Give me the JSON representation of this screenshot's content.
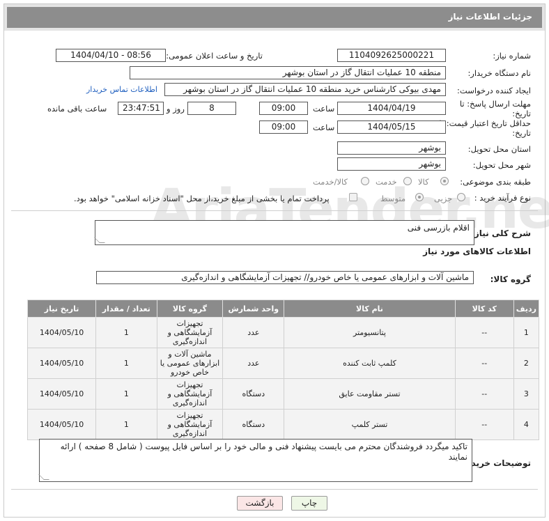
{
  "header": {
    "title": "جزئیات اطلاعات نیاز"
  },
  "fields": {
    "need_number_label": "شماره نیاز:",
    "need_number": "1104092625000221",
    "announce_label": "تاریخ و ساعت اعلان عمومی:",
    "announce_value": "1404/04/10 - 08:56",
    "buyer_org_label": "نام دستگاه خریدار:",
    "buyer_org": "منطقه 10 عملیات انتقال گاز در استان بوشهر",
    "requester_label": "ایجاد کننده درخواست:",
    "requester": "مهدی بیوکی کارشناس خرید منطقه 10 عملیات انتقال گاز در استان بوشهر",
    "contact_link": "اطلاعات تماس خریدار",
    "reply_deadline_label": "مهلت ارسال پاسخ: تا تاریخ:",
    "reply_date": "1404/04/19",
    "time_label": "ساعت",
    "reply_time": "09:00",
    "days_count": "8",
    "days_label": "روز و",
    "remaining_time": "23:47:51",
    "remaining_label": "ساعت باقی مانده",
    "price_deadline_label": "حداقل تاریخ اعتبار قیمت: تا تاریخ:",
    "price_date": "1404/05/15",
    "price_time": "09:00",
    "province_label": "استان محل تحویل:",
    "province": "بوشهر",
    "city_label": "شهر محل تحویل:",
    "city": "بوشهر",
    "category_label": "طبقه بندی موضوعی:",
    "category_options": [
      "کالا",
      "خدمت",
      "کالا/خدمت"
    ],
    "process_label": "نوع فرآیند خرید :",
    "process_options": [
      "جزیی",
      "متوسط"
    ],
    "payment_note": "پرداخت تمام یا بخشی از مبلغ خرید،از محل \"اسناد خزانه اسلامی\" خواهد بود.",
    "desc_label": "شرح کلی نیاز:",
    "desc_value": "اقلام بازرسی فنی",
    "goods_info_title": "اطلاعات کالاهای مورد نیاز",
    "goods_group_label": "گروه کالا:",
    "goods_group": "ماشین آلات و ابزارهای عمومی یا خاص خودرو// تجهیزات آزمایشگاهی و اندازه‌گیری"
  },
  "table": {
    "headers": [
      "ردیف",
      "کد کالا",
      "نام کالا",
      "واحد شمارش",
      "گروه کالا",
      "تعداد / مقدار",
      "تاریخ نیاز"
    ],
    "rows": [
      [
        "1",
        "--",
        "پتانسیومتر",
        "عدد",
        "تجهیزات آزمایشگاهی و اندازه‌گیری",
        "1",
        "1404/05/10"
      ],
      [
        "2",
        "--",
        "کلمپ ثابت کننده",
        "عدد",
        "ماشین آلات و ابزارهای عمومی یا خاص خودرو",
        "1",
        "1404/05/10"
      ],
      [
        "3",
        "--",
        "تستر مقاومت عایق",
        "دستگاه",
        "تجهیزات آزمایشگاهی و اندازه‌گیری",
        "1",
        "1404/05/10"
      ],
      [
        "4",
        "--",
        "تستر کلمپ",
        "دستگاه",
        "تجهیزات آزمایشگاهی و اندازه‌گیری",
        "1",
        "1404/05/10"
      ]
    ]
  },
  "buyer_notes_label": "توضیحات خریدار:",
  "buyer_notes": "تاکید میگردد فروشندگان محترم می بایست پیشنهاد فنی و مالی خود را بر اساس فایل پیوست ( شامل 8 صفحه ) ارائه نمایند",
  "buttons": {
    "print": "چاپ",
    "back": "بازگشت"
  },
  "watermark": "AriaTender.neT"
}
